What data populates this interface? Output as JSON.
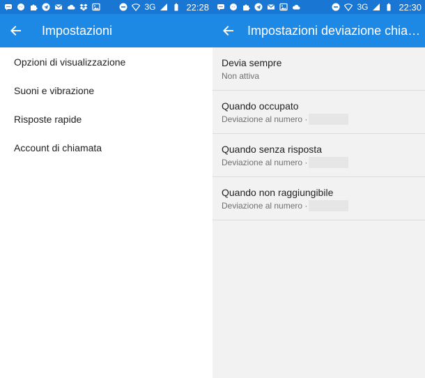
{
  "left": {
    "status": {
      "network": "3G",
      "time": "22:28"
    },
    "title": "Impostazioni",
    "items": [
      {
        "label": "Opzioni di visualizzazione"
      },
      {
        "label": "Suoni e vibrazione"
      },
      {
        "label": "Risposte rapide"
      },
      {
        "label": "Account di chiamata"
      }
    ]
  },
  "right": {
    "status": {
      "network": "3G",
      "time": "22:30"
    },
    "title": "Impostazioni deviazione chia…",
    "items": [
      {
        "title": "Devia sempre",
        "subtitle": "Non attiva"
      },
      {
        "title": "Quando occupato",
        "subtitle": "Deviazione al numero ·"
      },
      {
        "title": "Quando senza risposta",
        "subtitle": "Deviazione al numero ·"
      },
      {
        "title": "Quando non raggiungibile",
        "subtitle": "Deviazione al numero ·"
      }
    ]
  },
  "icons": [
    "message-icon",
    "messenger-icon",
    "puzzle-icon",
    "telegram-icon",
    "gmail-icon",
    "cloud-icon",
    "dropbox-icon",
    "image-icon",
    "dnd-icon",
    "wifi-icon",
    "signal-icon",
    "battery-icon",
    "back-arrow-icon"
  ],
  "colors": {
    "statusbar": "#1976d2",
    "appbar": "#1e88e5",
    "right_bg": "#f2f2f2",
    "divider": "#dcdcdc"
  }
}
